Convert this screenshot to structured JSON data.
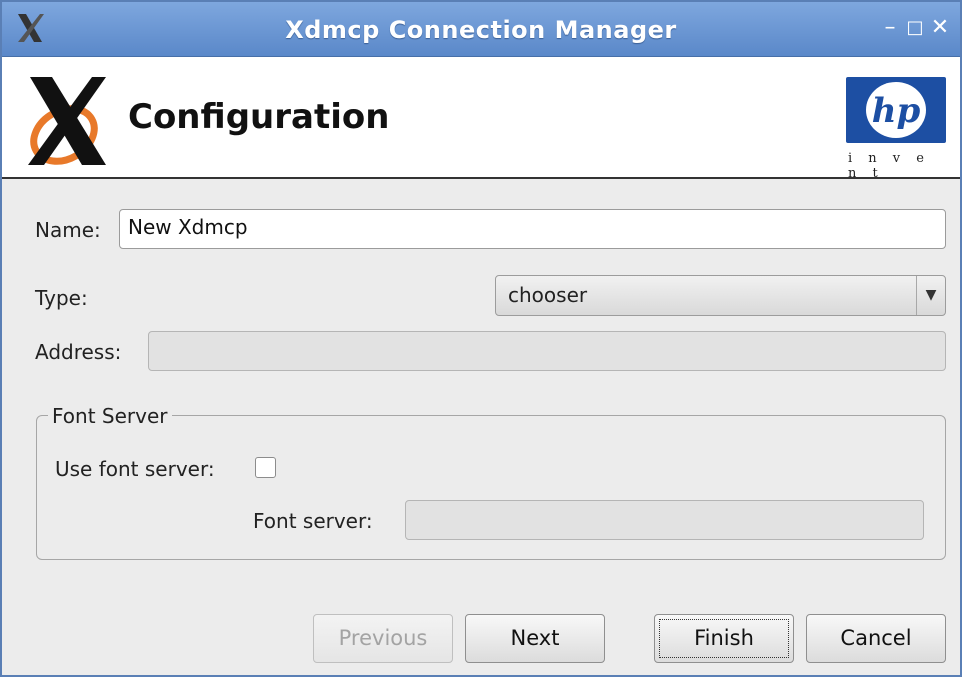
{
  "window": {
    "title": "Xdmcp Connection Manager",
    "controls": {
      "minimize": "–",
      "maximize": "□",
      "close": "✕"
    }
  },
  "header": {
    "title": "Configuration",
    "brand_logo_text": "hp",
    "brand_tagline": "i n v e n t",
    "brand_color": "#1d4fa3"
  },
  "form": {
    "name_label": "Name:",
    "name_value": "New Xdmcp",
    "type_label": "Type:",
    "type_value": "chooser",
    "address_label": "Address:",
    "address_value": ""
  },
  "font_server_group": {
    "title": "Font Server",
    "use_label": "Use font server:",
    "use_checked": false,
    "server_label": "Font server:",
    "server_value": ""
  },
  "buttons": {
    "previous": "Previous",
    "next": "Next",
    "finish": "Finish",
    "cancel": "Cancel"
  }
}
